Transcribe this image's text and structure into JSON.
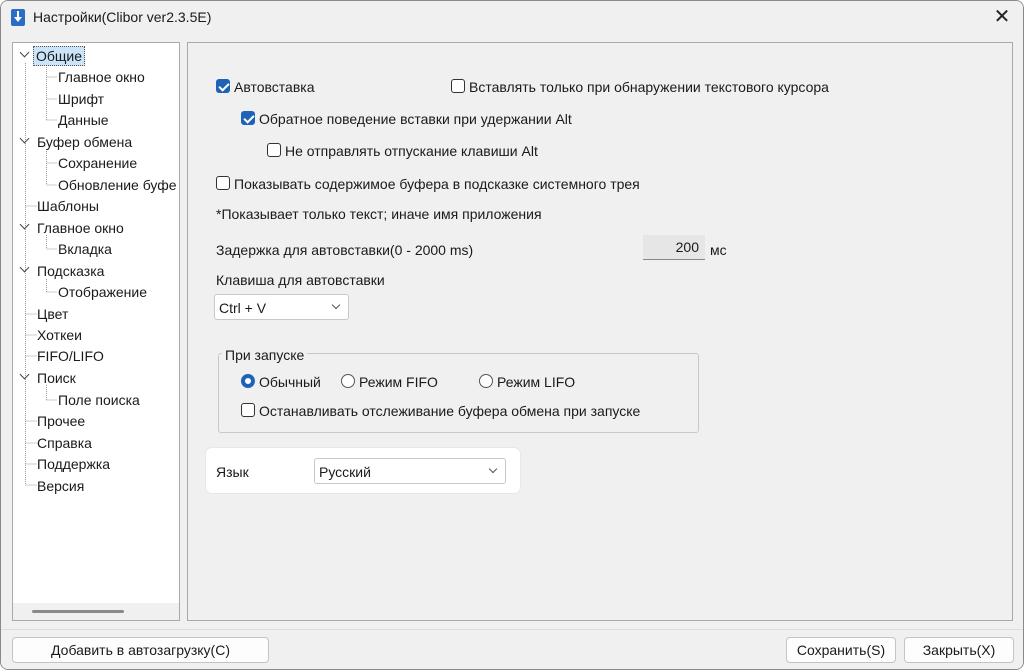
{
  "window": {
    "title": "Настройки(Clibor ver2.3.5E)",
    "close_glyph": "✕"
  },
  "tree": {
    "items": [
      {
        "label": "Общие",
        "level": 0,
        "expandable": true,
        "selected": true
      },
      {
        "label": "Главное окно",
        "level": 1
      },
      {
        "label": "Шрифт",
        "level": 1
      },
      {
        "label": "Данные",
        "level": 1
      },
      {
        "label": "Буфер обмена",
        "level": 0,
        "expandable": true
      },
      {
        "label": "Сохранение",
        "level": 1
      },
      {
        "label": "Обновление буфе",
        "level": 1
      },
      {
        "label": "Шаблоны",
        "level": 0
      },
      {
        "label": "Главное окно",
        "level": 0,
        "expandable": true
      },
      {
        "label": "Вкладка",
        "level": 1
      },
      {
        "label": "Подсказка",
        "level": 0,
        "expandable": true
      },
      {
        "label": "Отображение",
        "level": 1
      },
      {
        "label": "Цвет",
        "level": 0
      },
      {
        "label": "Хоткеи",
        "level": 0
      },
      {
        "label": "FIFO/LIFO",
        "level": 0
      },
      {
        "label": "Поиск",
        "level": 0,
        "expandable": true
      },
      {
        "label": "Поле поиска",
        "level": 1
      },
      {
        "label": "Прочее",
        "level": 0
      },
      {
        "label": "Справка",
        "level": 0
      },
      {
        "label": "Поддержка",
        "level": 0
      },
      {
        "label": "Версия",
        "level": 0
      }
    ]
  },
  "general": {
    "autopaste": {
      "label": "Автовставка",
      "checked": true
    },
    "paste_only_cursor": {
      "label": "Вставлять только при обнаружении текстового курсора",
      "checked": false
    },
    "reverse_alt": {
      "label": "Обратное поведение вставки при удержании Alt",
      "checked": true
    },
    "no_alt_release": {
      "label": "Не отправлять отпускание клавиши Alt",
      "checked": false
    },
    "show_tray_tip": {
      "label": "Показывать содержимое буфера в подсказке системного трея",
      "checked": false
    },
    "tray_note": "*Показывает только текст; иначе имя приложения",
    "delay_label": "Задержка для автовставки(0 - 2000 ms)",
    "delay_value": "200",
    "delay_unit": "мс",
    "key_label": "Клавиша для автовставки",
    "key_value": "Ctrl + V",
    "startup": {
      "title": "При запуске",
      "modes": [
        "Обычный",
        "Режим FIFO",
        "Режим LIFO"
      ],
      "selected_mode": "Обычный",
      "stop_monitoring": {
        "label": "Останавливать отслеживание буфера обмена при запуске",
        "checked": false
      }
    },
    "language_label": "Язык",
    "language_value": "Русский"
  },
  "buttons": {
    "autostart": "Добавить в автозагрузку(C)",
    "save": "Сохранить(S)",
    "close": "Закрыть(X)"
  }
}
